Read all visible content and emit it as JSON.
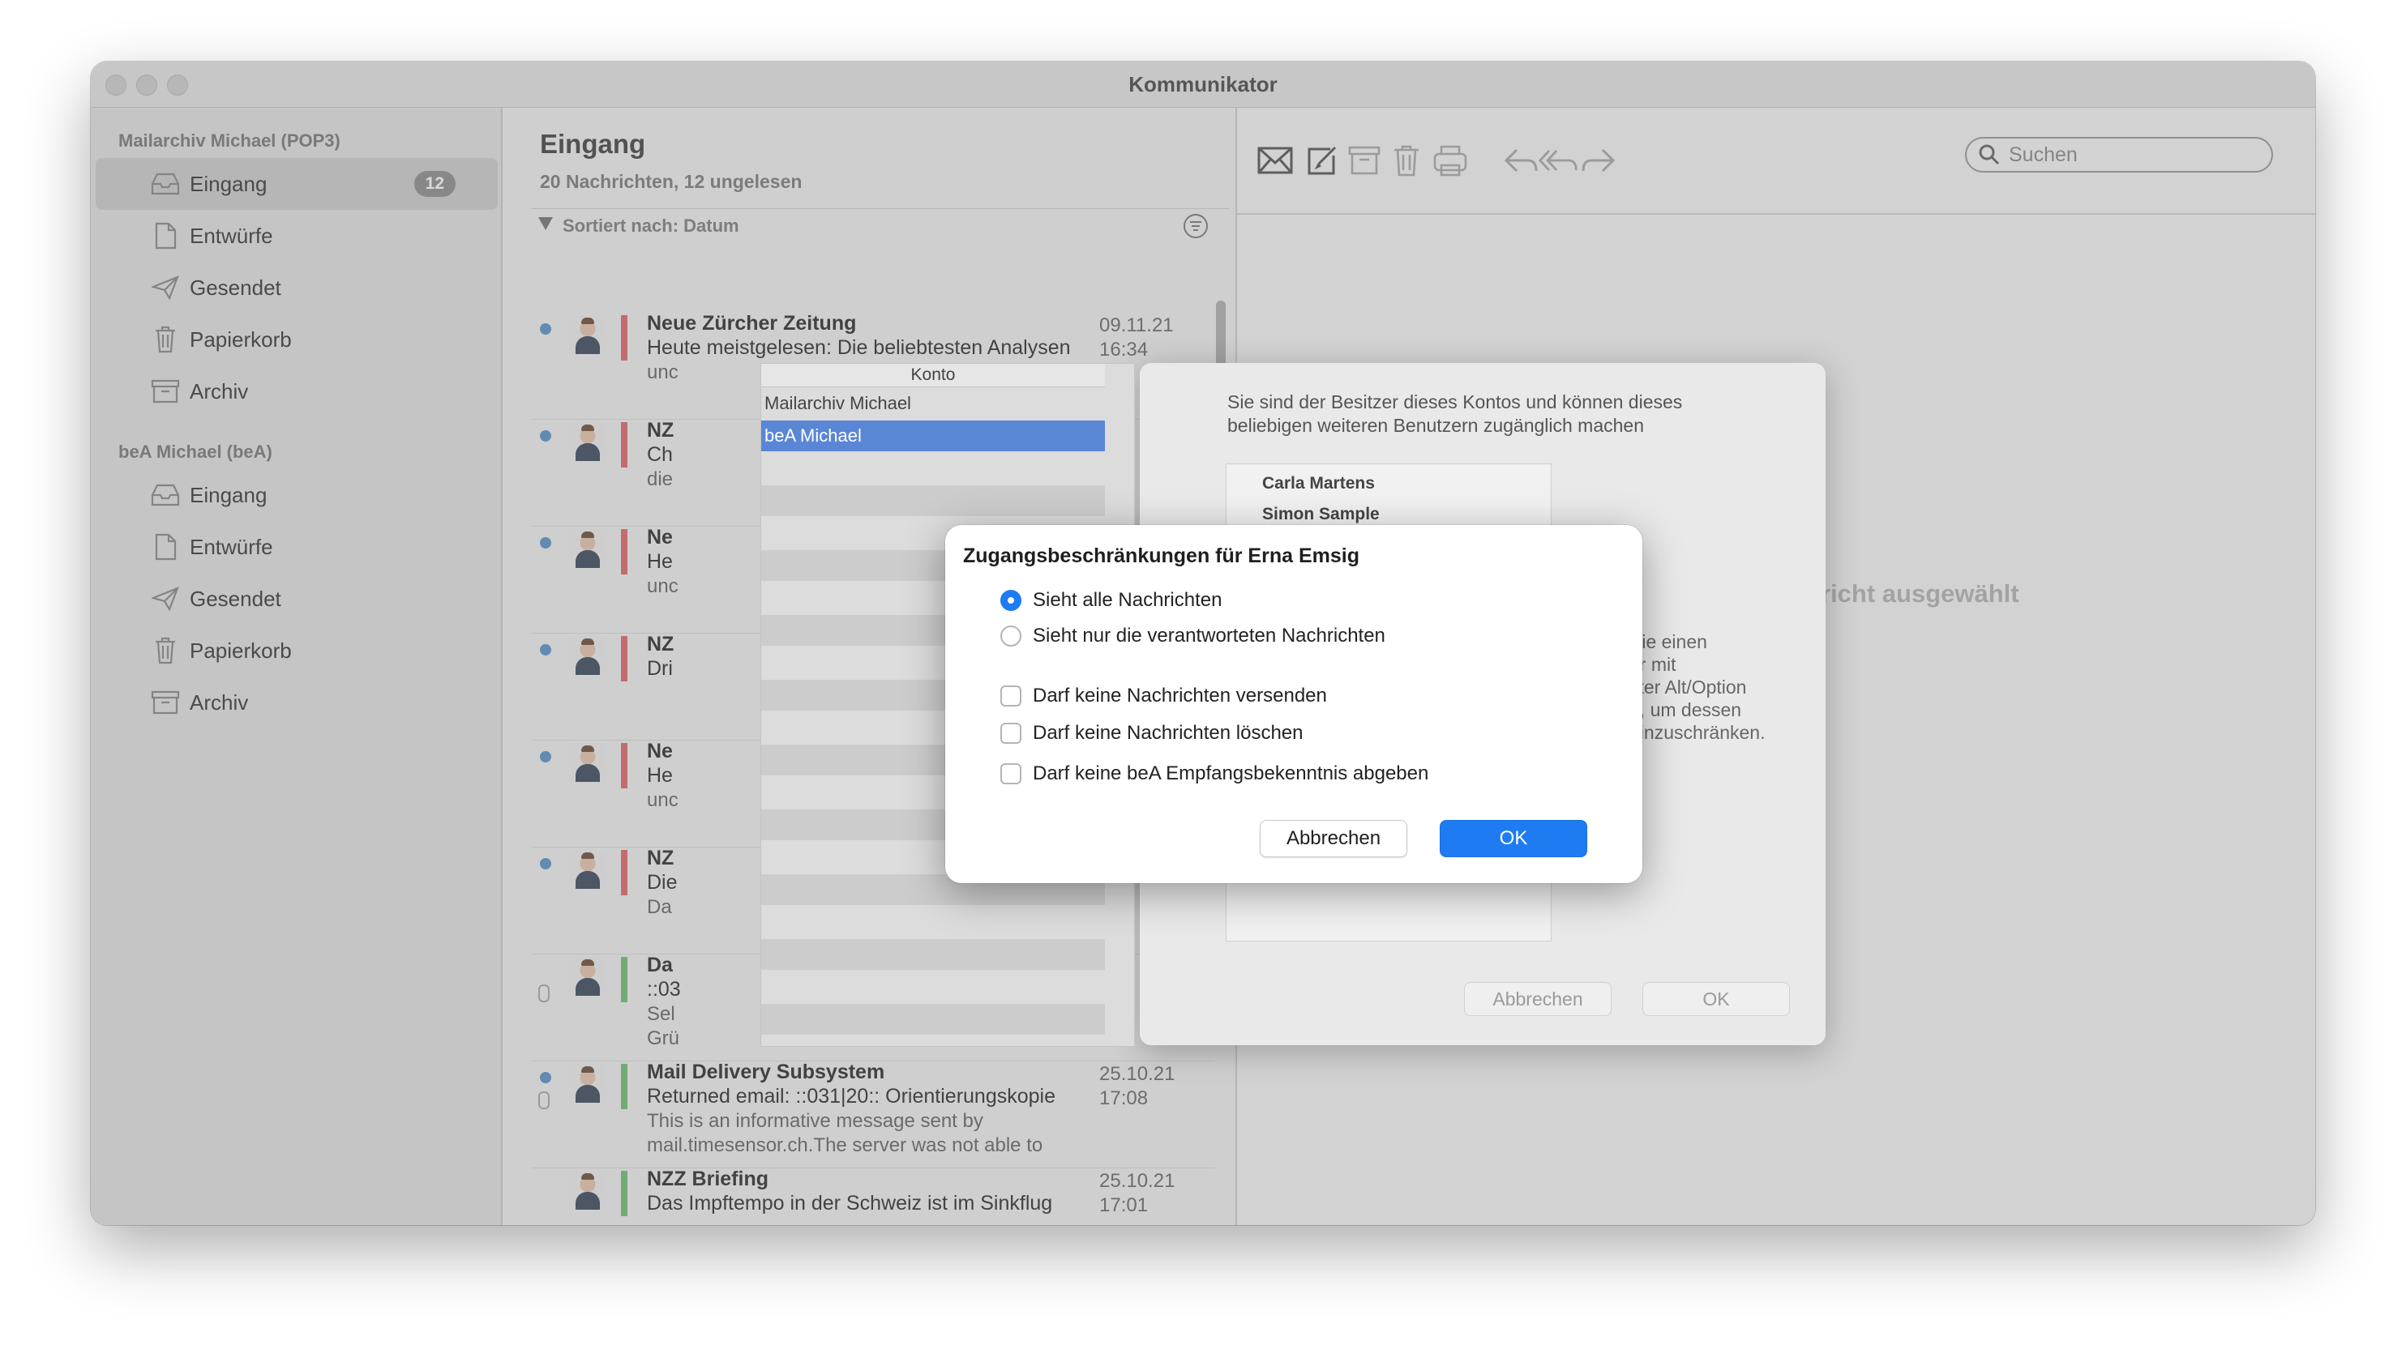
{
  "window": {
    "title": "Kommunikator"
  },
  "sidebar": {
    "accounts": [
      {
        "name": "Mailarchiv Michael (POP3)",
        "folders": [
          {
            "label": "Eingang",
            "icon": "inbox-icon",
            "badge": "12",
            "selected": true
          },
          {
            "label": "Entwürfe",
            "icon": "document-icon"
          },
          {
            "label": "Gesendet",
            "icon": "paper-plane-icon"
          },
          {
            "label": "Papierkorb",
            "icon": "trash-icon"
          },
          {
            "label": "Archiv",
            "icon": "archive-box-icon"
          }
        ]
      },
      {
        "name": "beA Michael (beA)",
        "folders": [
          {
            "label": "Eingang",
            "icon": "inbox-icon"
          },
          {
            "label": "Entwürfe",
            "icon": "document-icon"
          },
          {
            "label": "Gesendet",
            "icon": "paper-plane-icon"
          },
          {
            "label": "Papierkorb",
            "icon": "trash-icon"
          },
          {
            "label": "Archiv",
            "icon": "archive-box-icon"
          }
        ]
      }
    ]
  },
  "list": {
    "title": "Eingang",
    "subtitle": "20 Nachrichten, 12 ungelesen",
    "sort_label": "Sortiert nach: Datum",
    "messages": [
      {
        "from": "Neue Zürcher Zeitung",
        "subject": "Heute meistgelesen: Die beliebtesten Analysen",
        "preview": "unc",
        "date": "09.11.21",
        "time": "16:34",
        "unread": true,
        "color": "red"
      },
      {
        "from": "NZ",
        "subject": "Ch",
        "preview": "die",
        "date": "",
        "time": "",
        "unread": true,
        "color": "red"
      },
      {
        "from": "Ne",
        "subject": "He",
        "preview": "unc",
        "date": "",
        "time": "",
        "unread": true,
        "color": "red"
      },
      {
        "from": "NZ",
        "subject": "Dri",
        "preview": "",
        "date": "",
        "time": "",
        "unread": true,
        "color": "red"
      },
      {
        "from": "Ne",
        "subject": "He",
        "preview": "unc",
        "date": "",
        "time": "",
        "unread": true,
        "color": "red"
      },
      {
        "from": "NZ",
        "subject": "Die",
        "preview": "Da",
        "date": "",
        "time": "",
        "unread": true,
        "color": "red"
      },
      {
        "from": "Da",
        "subject": "::03",
        "preview": "Sel\nGrü",
        "date": "",
        "time": "",
        "unread": false,
        "attachment": true,
        "color": "green"
      },
      {
        "from": "Mail Delivery Subsystem",
        "subject": "Returned email: ::031|20:: Orientierungskopie",
        "preview": "This is an informative message sent by\nmail.timesensor.ch.The server was not able to",
        "date": "25.10.21",
        "time": "17:08",
        "unread": true,
        "attachment": true,
        "color": "green"
      },
      {
        "from": "NZZ Briefing",
        "subject": "Das Impftempo in der Schweiz ist im Sinkflug",
        "preview": "",
        "date": "25.10.21",
        "time": "17:01",
        "unread": false,
        "color": "green"
      }
    ]
  },
  "reading": {
    "search_placeholder": "Suchen",
    "empty_text": "richt ausgewählt",
    "toolbar_icons": [
      "envelope-icon",
      "compose-icon",
      "archive-icon",
      "trash-icon",
      "print-icon",
      "reply-icon",
      "reply-all-icon",
      "forward-icon"
    ]
  },
  "sheet": {
    "description": "Sie sind der Besitzer dieses Kontos und können dieses beliebigen weiteren Benutzern zugänglich machen",
    "users": [
      "Carla Martens",
      "Simon Sample"
    ],
    "hint": "Sie einen\ner mit\nkter Alt/Option\nn, um dessen\neinzuschränken.",
    "cancel_label": "Abbrechen",
    "ok_label": "OK"
  },
  "konto": {
    "header": "Konto",
    "rows": [
      "Mailarchiv Michael",
      "beA Michael"
    ],
    "selected_index": 1
  },
  "modal": {
    "title": "Zugangsbeschränkungen für Erna Emsig",
    "radio_options": [
      {
        "label": "Sieht alle Nachrichten",
        "checked": true
      },
      {
        "label": "Sieht nur die verantworteten Nachrichten",
        "checked": false
      }
    ],
    "checkboxes": [
      {
        "label": "Darf keine Nachrichten versenden",
        "checked": false
      },
      {
        "label": "Darf keine Nachrichten löschen",
        "checked": false
      },
      {
        "label": "Darf keine beA Empfangsbekenntnis abgeben",
        "checked": false
      }
    ],
    "cancel_label": "Abbrechen",
    "ok_label": "OK"
  },
  "colors": {
    "accent": "#1f7bf2",
    "selection": "#5a86d6",
    "red_flag": "#e06a6a",
    "green_flag": "#6fbf73",
    "unread_dot": "#5a93c8"
  }
}
